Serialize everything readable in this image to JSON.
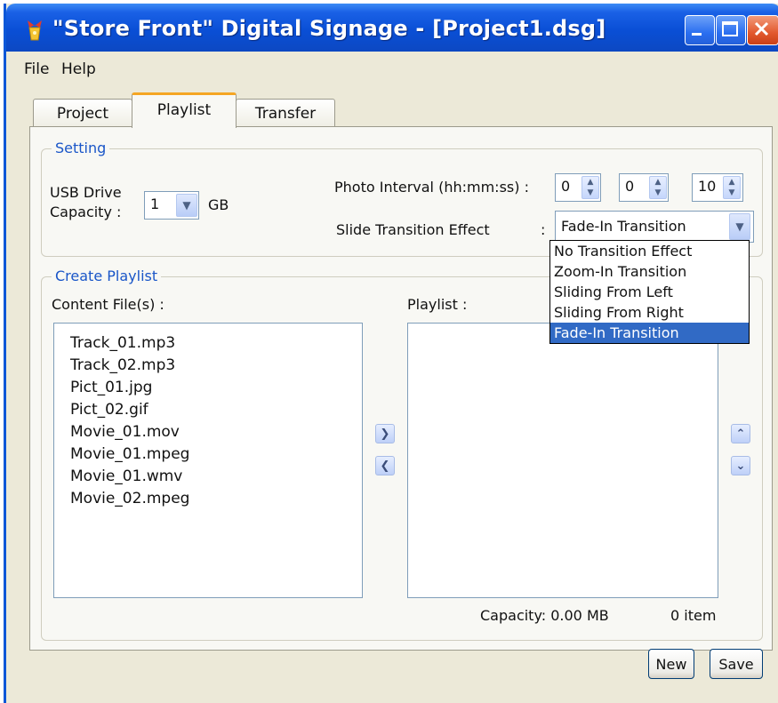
{
  "window": {
    "title": "\"Store Front\" Digital Signage - [Project1.dsg]",
    "controls": [
      "minimize-icon",
      "maximize-icon",
      "close-icon"
    ]
  },
  "menu": {
    "file": "File",
    "help": "Help"
  },
  "tabs": [
    {
      "label": "Project",
      "active": false
    },
    {
      "label": "Playlist",
      "active": true
    },
    {
      "label": "Transfer",
      "active": false
    }
  ],
  "setting": {
    "title": "Setting",
    "usb_label_line1": "USB Drive",
    "usb_label_line2": "Capacity :",
    "usb_value": "1",
    "usb_unit": "GB",
    "photo_interval_label": "Photo Interval (hh:mm:ss) :",
    "interval_hh": "0",
    "interval_mm": "0",
    "interval_ss": "10",
    "transition_label": "Slide Transition Effect",
    "transition_colon": ":",
    "transition_value": "Fade-In Transition",
    "transition_options": [
      "No Transition Effect",
      "Zoom-In Transition",
      "Sliding From Left",
      "Sliding From Right",
      "Fade-In Transition"
    ],
    "transition_selected_index": 4
  },
  "create_playlist": {
    "title": "Create Playlist",
    "content_label": "Content File(s) :",
    "playlist_label": "Playlist :",
    "content_files": [
      "Track_01.mp3",
      "Track_02.mp3",
      "Pict_01.jpg",
      "Pict_02.gif",
      "Movie_01.mov",
      "Movie_01.mpeg",
      "Movie_01.wmv",
      "Movie_02.mpeg"
    ],
    "playlist_items": [],
    "capacity": "Capacity: 0.00 MB",
    "item_count": "0 item"
  },
  "buttons": {
    "new": "New",
    "save": "Save"
  },
  "colors": {
    "titlebar": "#0a4fd6",
    "group_title": "#1a56c8",
    "selection": "#316ac5",
    "active_tab_accent": "#f5a623"
  }
}
